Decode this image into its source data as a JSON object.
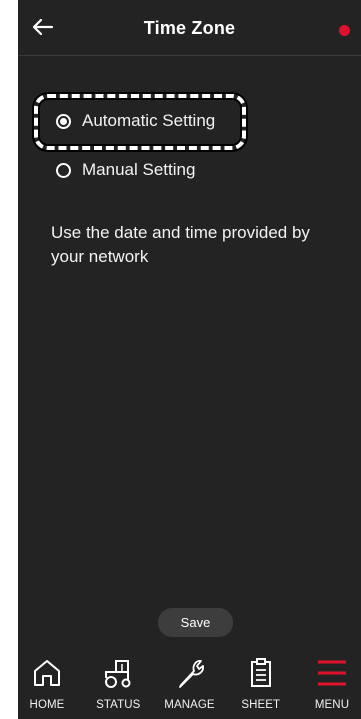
{
  "header": {
    "title": "Time Zone",
    "back_icon": "back-arrow-icon",
    "indicator_color": "#e0112b"
  },
  "time_zone": {
    "options": [
      {
        "label": "Automatic Setting",
        "selected": true
      },
      {
        "label": "Manual Setting",
        "selected": false
      }
    ],
    "description": "Use the date and time provided by your network"
  },
  "save_label": "Save",
  "tabbar": {
    "items": [
      {
        "label": "HOME",
        "icon": "home-icon",
        "active": false
      },
      {
        "label": "STATUS",
        "icon": "tractor-icon",
        "active": false
      },
      {
        "label": "MANAGE",
        "icon": "wrench-icon",
        "active": false
      },
      {
        "label": "SHEET",
        "icon": "clipboard-icon",
        "active": false
      },
      {
        "label": "MENU",
        "icon": "menu-icon",
        "active": true
      }
    ]
  },
  "colors": {
    "background": "#232323",
    "accent": "#e0112b",
    "text": "#ffffff"
  }
}
